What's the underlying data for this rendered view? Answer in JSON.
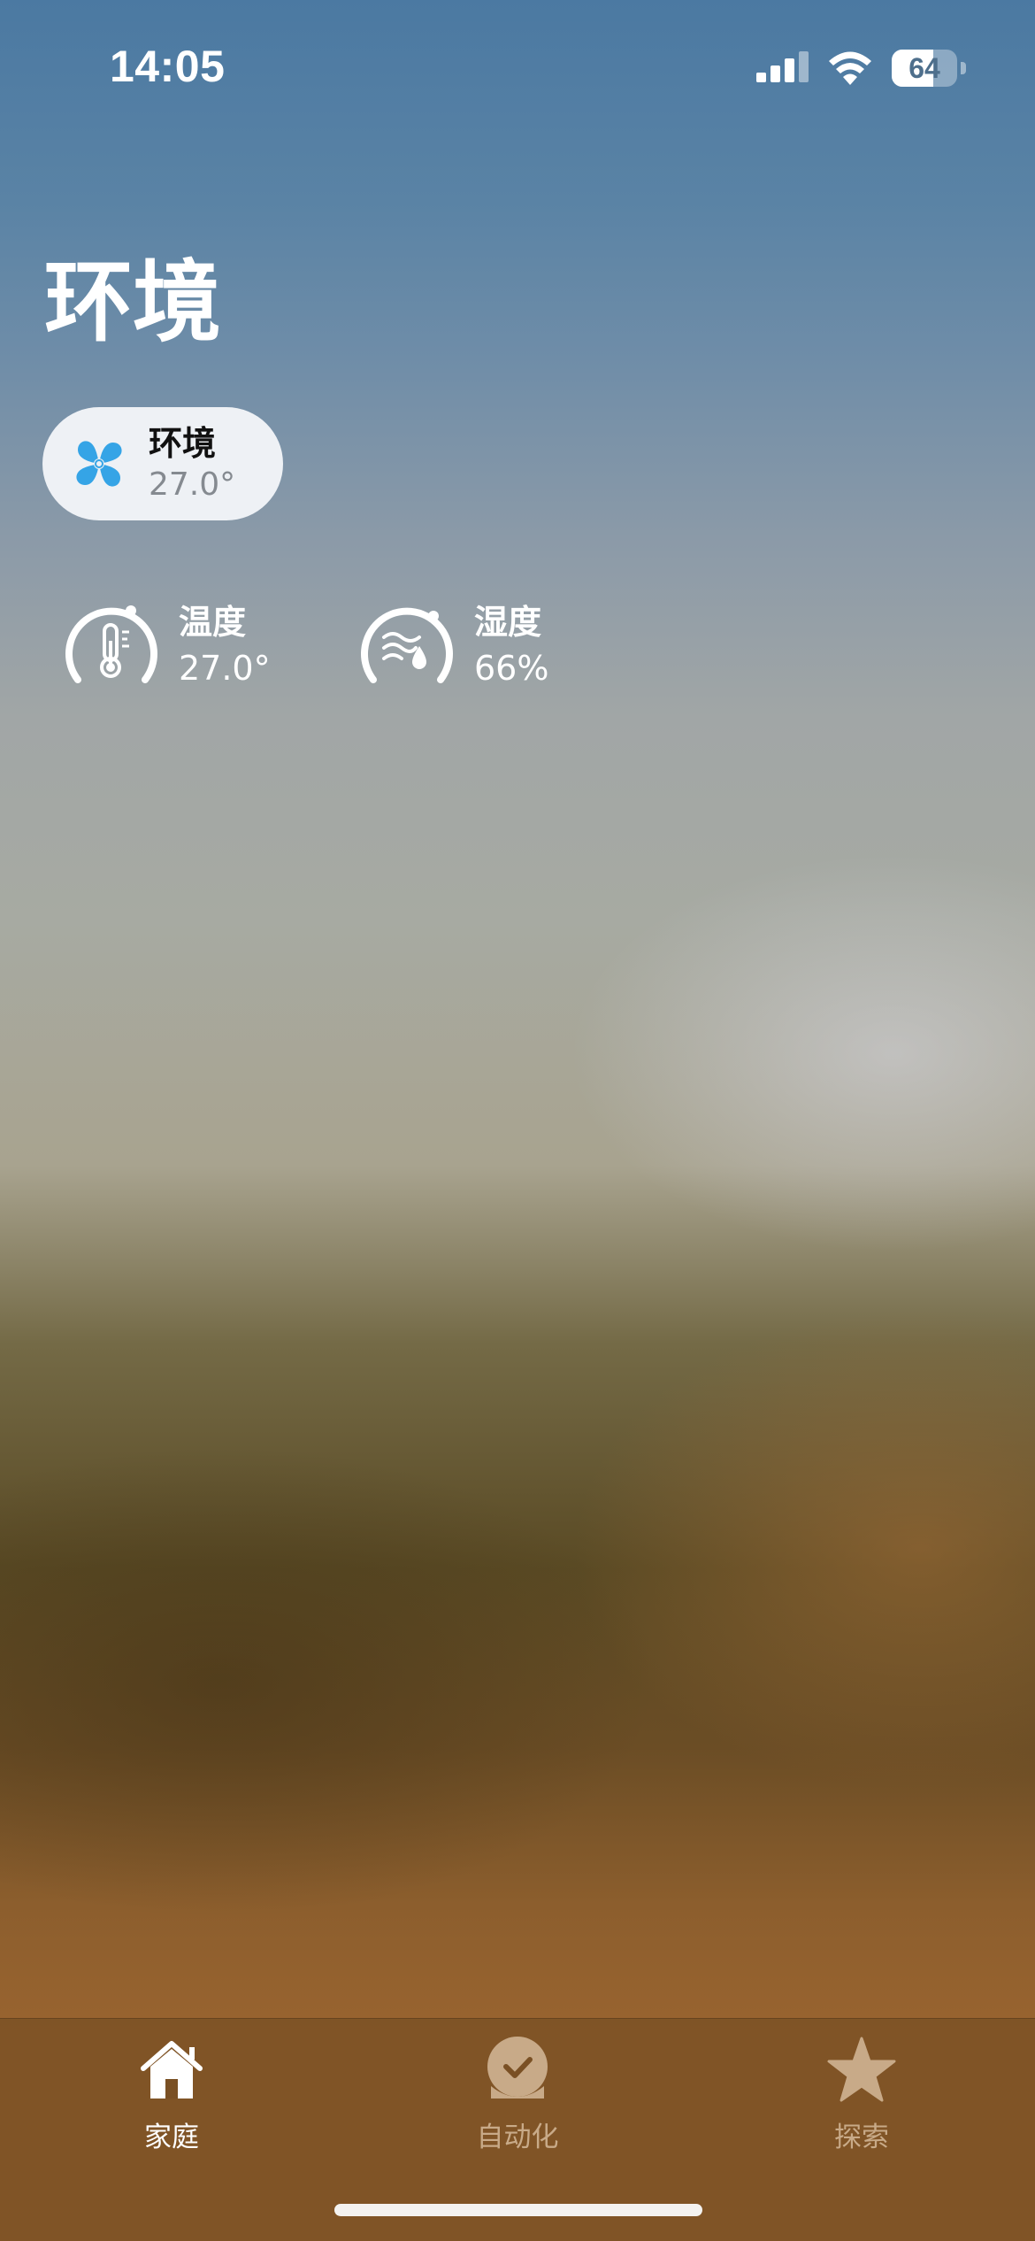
{
  "status_bar": {
    "time": "14:05",
    "battery_level": "64",
    "battery_fraction": 0.64,
    "signal_icon": "cellular-signal-icon",
    "wifi_icon": "wifi-icon"
  },
  "page": {
    "title": "环境"
  },
  "room": {
    "name": "环境",
    "value": "27.0°",
    "icon": "fan-icon",
    "icon_color": "#35a4e6"
  },
  "sensors": [
    {
      "label": "温度",
      "value": "27.0°",
      "icon": "thermometer-icon"
    },
    {
      "label": "湿度",
      "value": "66%",
      "icon": "humidity-icon"
    }
  ],
  "tabbar": {
    "tabs": [
      {
        "label": "家庭",
        "icon": "house-icon",
        "active": true
      },
      {
        "label": "自动化",
        "icon": "automation-clock-icon",
        "active": false
      },
      {
        "label": "探索",
        "icon": "star-icon",
        "active": false
      }
    ],
    "active_color": "#ffffff",
    "inactive_color": "#c8aa88"
  }
}
